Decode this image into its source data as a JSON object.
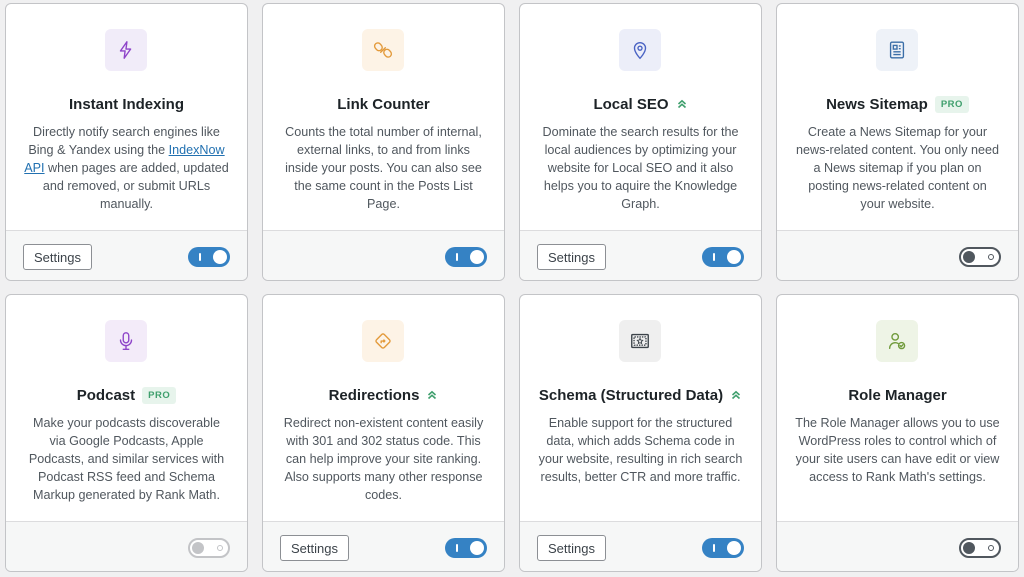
{
  "modules": [
    {
      "title": "Instant Indexing",
      "desc_before": "Directly notify search engines like Bing & Yandex using the ",
      "link": "IndexNow API",
      "desc_after": " when pages are added, updated and removed, or submit URLs manually.",
      "settings_label": "Settings",
      "enabled": true,
      "icon": "lightning-icon"
    },
    {
      "title": "Link Counter",
      "description": "Counts the total number of internal, external links, to and from links inside your posts. You can also see the same count in the Posts List Page.",
      "enabled": true,
      "icon": "link-icon"
    },
    {
      "title": "Local SEO",
      "description": "Dominate the search results for the local audiences by optimizing your website for Local SEO and it also helps you to aquire the Knowledge Graph.",
      "settings_label": "Settings",
      "enabled": true,
      "icon": "map-pin-icon"
    },
    {
      "title": "News Sitemap",
      "badge": "PRO",
      "description": "Create a News Sitemap for your news-related content. You only need a News sitemap if you plan on posting news-related content on your website.",
      "enabled": false,
      "icon": "newspaper-icon"
    },
    {
      "title": "Podcast",
      "badge": "PRO",
      "description": "Make your podcasts discoverable via Google Podcasts, Apple Podcasts, and similar services with Podcast RSS feed and Schema Markup generated by Rank Math.",
      "enabled": false,
      "icon": "microphone-icon"
    },
    {
      "title": "Redirections",
      "description": "Redirect non-existent content easily with 301 and 302 status code. This can help improve your site ranking. Also supports many other response codes.",
      "settings_label": "Settings",
      "enabled": true,
      "icon": "redirect-sign-icon"
    },
    {
      "title": "Schema (Structured Data)",
      "description": "Enable support for the structured data, which adds Schema code in your website, resulting in rich search results, better CTR and more traffic.",
      "settings_label": "Settings",
      "enabled": true,
      "icon": "certificate-icon"
    },
    {
      "title": "Role Manager",
      "description": "The Role Manager allows you to use WordPress roles to control which of your site users can have edit or view access to Rank Math's settings.",
      "enabled": false,
      "icon": "user-check-icon"
    }
  ],
  "colors": {
    "accent": "#3582c4",
    "advanced_chevron": "#3f9f6d",
    "pro_badge_text": "#3f9f6d",
    "pro_badge_bg": "#e7f4ec"
  }
}
